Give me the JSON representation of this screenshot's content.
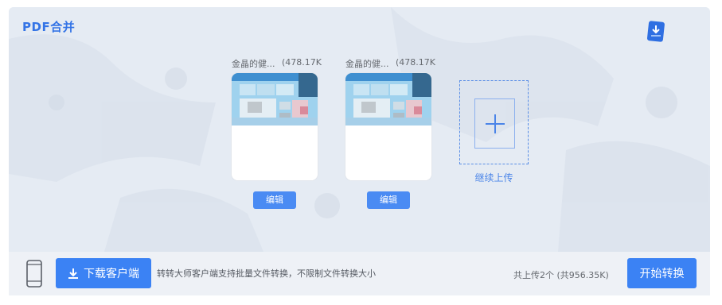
{
  "app": {
    "title": "PDF合并"
  },
  "files": [
    {
      "name": "金晶的健...",
      "size": "(478.17K",
      "edit_label": "编辑"
    },
    {
      "name": "金晶的健...",
      "size": "(478.17K",
      "edit_label": "编辑"
    }
  ],
  "add": {
    "label": "继续上传"
  },
  "footer": {
    "download_client_label": "下载客户端",
    "note": "转转大师客户端支持批量文件转换，不限制文件转换大小",
    "upload_count": "共上传2个 (共956.35K)",
    "start_label": "开始转换"
  },
  "colors": {
    "accent": "#3b82f4",
    "title": "#3474e6",
    "panel_bg": "#e5ebf3"
  }
}
